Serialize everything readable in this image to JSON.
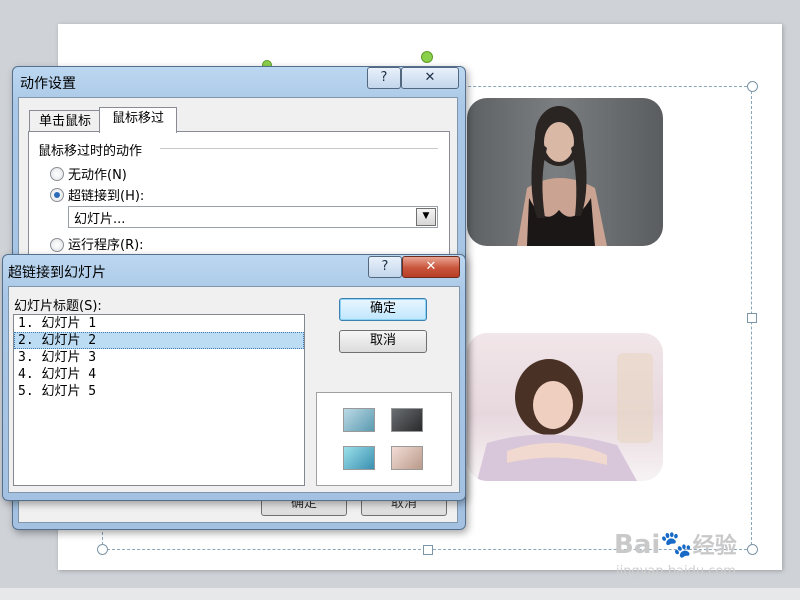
{
  "action_dialog": {
    "title": "动作设置",
    "help_label": "?",
    "close_label": "✕",
    "tabs": [
      {
        "label": "单击鼠标"
      },
      {
        "label": "鼠标移过"
      }
    ],
    "group_label": "鼠标移过时的动作",
    "options": {
      "no_action": "无动作(N)",
      "hyperlink": "超链接到(H):",
      "run_program": "运行程序(R):"
    },
    "hyperlink_value": "幻灯片...",
    "ok_label": "确定",
    "cancel_label": "取消"
  },
  "link_dialog": {
    "title": "超链接到幻灯片",
    "help_label": "?",
    "close_label": "✕",
    "list_label": "幻灯片标题(S):",
    "slides": [
      {
        "label": "1. 幻灯片 1"
      },
      {
        "label": "2. 幻灯片 2"
      },
      {
        "label": "3. 幻灯片 3"
      },
      {
        "label": "4. 幻灯片 4"
      },
      {
        "label": "5. 幻灯片 5"
      }
    ],
    "selected_index": 1,
    "ok_label": "确定",
    "cancel_label": "取消"
  },
  "watermark": {
    "brand": "Bai",
    "brand_suffix": "经验",
    "url": "jingyan.baidu.com"
  },
  "colors": {
    "accent": "#3a78b8",
    "selection": "#bcdcf4",
    "rotate_handle": "#8ad04a"
  }
}
